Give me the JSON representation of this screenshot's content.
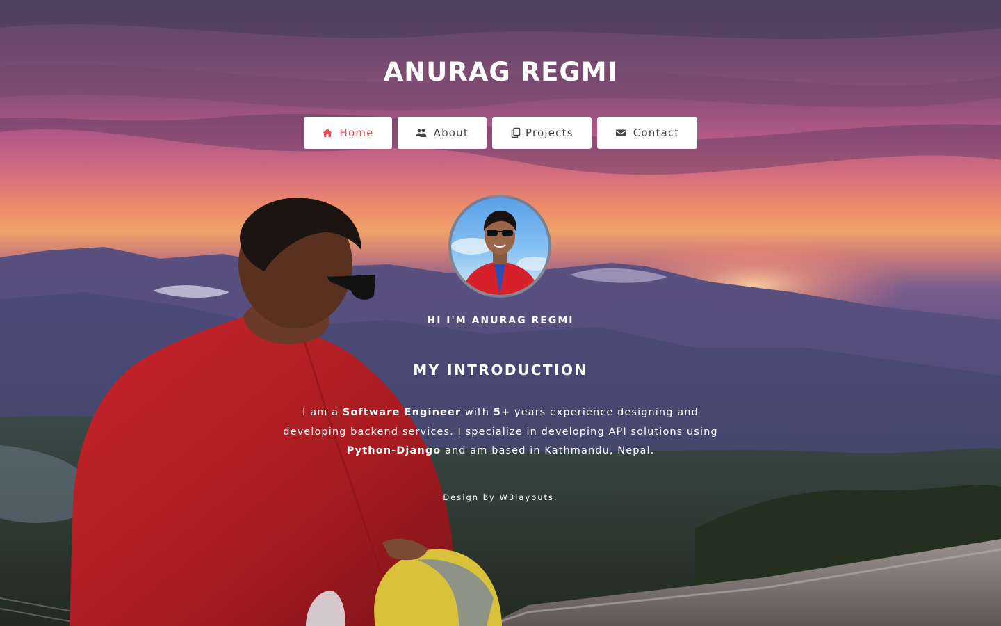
{
  "site": {
    "title": "ANURAG REGMI"
  },
  "nav": {
    "items": [
      {
        "label": "Home",
        "icon": "home-icon",
        "active": true
      },
      {
        "label": "About",
        "icon": "users-icon",
        "active": false
      },
      {
        "label": "Projects",
        "icon": "copy-icon",
        "active": false
      },
      {
        "label": "Contact",
        "icon": "envelope-icon",
        "active": false
      }
    ]
  },
  "hero": {
    "greeting": "HI I'M ANURAG REGMI",
    "section_title": "MY INTRODUCTION",
    "intro": {
      "p1": "I am a ",
      "role": "Software Engineer",
      "p2": " with ",
      "years": "5+",
      "p3": " years experience designing and developing backend services. I specialize in developing API solutions using ",
      "tech": "Python-Django",
      "p4": " and am based in Kathmandu, Nepal."
    }
  },
  "footer": {
    "credit_prefix": "Design by ",
    "credit_link": "W3layouts",
    "credit_suffix": "."
  },
  "colors": {
    "accent": "#ef4f5a",
    "button_bg": "#ffffff",
    "button_text": "#444444",
    "text": "#ffffff"
  }
}
